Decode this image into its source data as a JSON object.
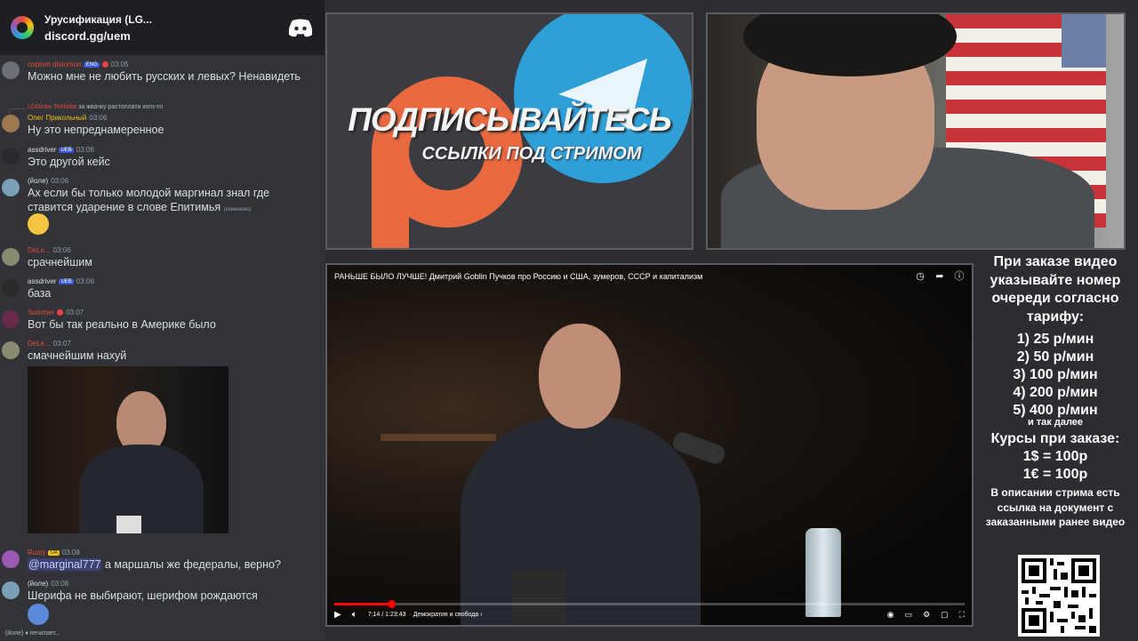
{
  "server": {
    "title": "Урусификация (LG...",
    "link": "discord.gg/uem"
  },
  "messages": [
    {
      "user": "copium distortion",
      "user_color": "#e74c3c",
      "badge": "ENG",
      "time": "03:05",
      "text": "Можно мне не любить русских и левых? Ненавидеть",
      "avatar": "#6b6f76"
    },
    {
      "reply_user": "LDGinko Teirliebe",
      "reply_text": "за жвачку растоплати кого-то",
      "user": "Олег Прикольный",
      "user_color": "#f1c40f",
      "time": "03:06",
      "text": "Ну это непреднамеренное",
      "avatar": "#a07850"
    },
    {
      "user": "assdriver",
      "user_color": "#dbdee1",
      "badge": "UEB",
      "time": "03:06",
      "text": "Это другой кейс",
      "avatar": "#2b2b2b"
    },
    {
      "user": "(йоле)",
      "user_color": "#dbdee1",
      "time": "03:06",
      "text": "Ах если бы только молодой маргинал знал где ставится ударение в слове Епитимья",
      "edited": "(изменено)",
      "avatar": "#7aa0b8"
    },
    {
      "user": "DeLe...",
      "user_color": "#e74c3c",
      "time": "03:06",
      "text": "срачнейшим",
      "avatar": "#8a8a70"
    },
    {
      "user": "assdriver",
      "user_color": "#dbdee1",
      "badge": "UEB",
      "time": "03:06",
      "text": "база",
      "avatar": "#2b2b2b"
    },
    {
      "user": "Summer",
      "user_color": "#e74c3c",
      "time": "03:07",
      "text": "Вот бы так реально в Америке было",
      "avatar": "#6a2a4a"
    },
    {
      "user": "DeLe...",
      "user_color": "#e74c3c",
      "time": "03:07",
      "text": "смачнейшим нахуй",
      "avatar": "#8a8a70"
    },
    {
      "user": "Rusty",
      "user_color": "#e74c3c",
      "badge": "UA",
      "time": "03:08",
      "mention": "@marginal777",
      "text": " а маршалы же федералы, верно?",
      "avatar": "#9b59b6"
    },
    {
      "user": "(йоле)",
      "user_color": "#dbdee1",
      "time": "03:08",
      "text": "Шерифа не выбирают, шерифом рождаются",
      "avatar": "#7aa0b8"
    }
  ],
  "typing": "(йоле) ♦ печатает...",
  "promo": {
    "line1": "ПОДПИСЫВАЙТЕСЬ",
    "line2": "ССЫЛКИ ПОД СТРИМОМ"
  },
  "video": {
    "title": "РАНЬШЕ БЫЛО ЛУЧШЕ! Дмитрий Goblin Пучков про Россию и США, зумеров, СССР и капитализм",
    "time": "7:14 / 1:23:43",
    "chapter": "· Демократия и свобода ›",
    "progress": 0.09
  },
  "info": {
    "intro": "При заказе видео указывайте номер очереди согласно тарифу:",
    "tariffs": [
      "1) 25 р/мин",
      "2) 50 р/мин",
      "3) 100 р/мин",
      "4) 200 р/мин",
      "5) 400 р/мин"
    ],
    "etc": "и так далее",
    "rates_title": "Курсы при заказе:",
    "rates": [
      "1$ = 100р",
      "1€ = 100р"
    ],
    "desc": "В описании стрима есть ссылка на документ с заказанными ранее видео"
  }
}
